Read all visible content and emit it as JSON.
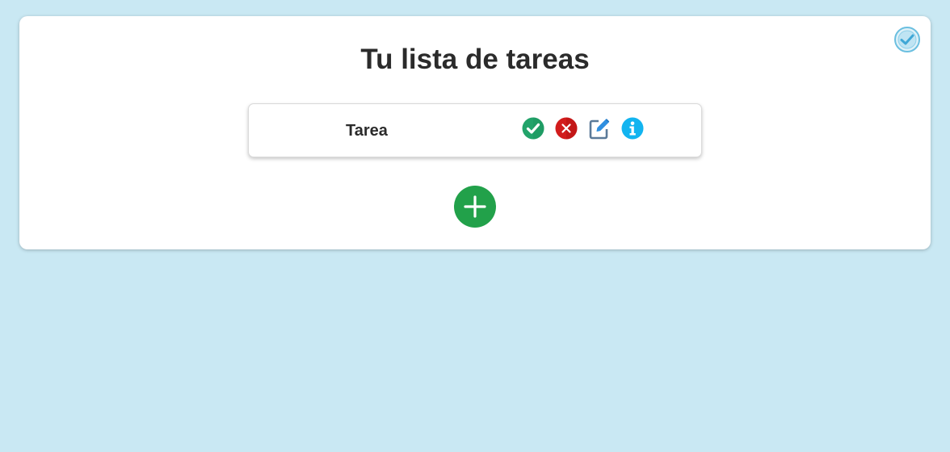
{
  "page": {
    "title": "Tu lista de tareas",
    "background_color": "#c9e8f3"
  },
  "header": {
    "corner_icon": "check-circle-icon"
  },
  "tasks": [
    {
      "label": "Tarea",
      "actions": [
        {
          "name": "complete",
          "icon": "check-circle-icon",
          "color": "#22a36a"
        },
        {
          "name": "delete",
          "icon": "x-circle-icon",
          "color": "#d21c1c"
        },
        {
          "name": "edit",
          "icon": "edit-icon",
          "color": "#5b7a99"
        },
        {
          "name": "info",
          "icon": "info-icon",
          "color": "#12b4f0"
        }
      ]
    }
  ],
  "add_button": {
    "icon": "plus-icon",
    "color": "#22a14a"
  }
}
